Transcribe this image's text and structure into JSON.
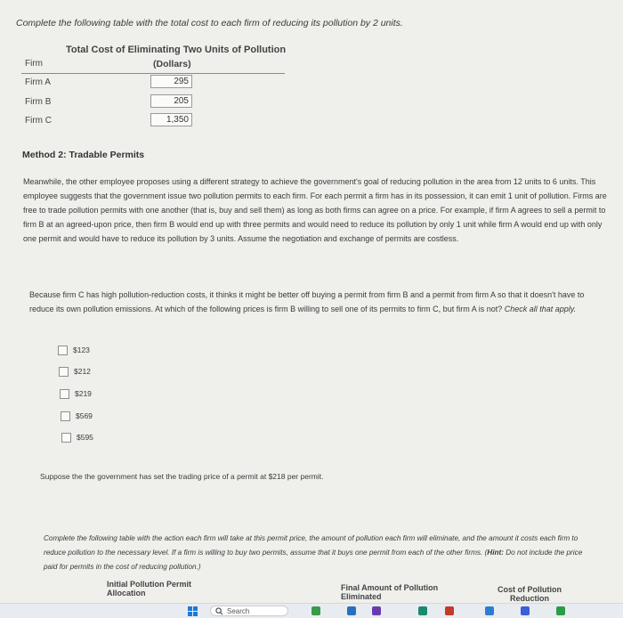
{
  "instructions_top": "Complete the following table with the total cost to each firm of reducing its pollution by 2 units.",
  "table1": {
    "title": "Total Cost of Eliminating Two Units of Pollution",
    "col_firm": "Firm",
    "col_cost": "(Dollars)",
    "rows": [
      {
        "firm": "Firm A",
        "value": "295"
      },
      {
        "firm": "Firm B",
        "value": "205"
      },
      {
        "firm": "Firm C",
        "value": "1,350"
      }
    ]
  },
  "method_heading": "Method 2: Tradable Permits",
  "paragraph1": "Meanwhile, the other employee proposes using a different strategy to achieve the government's goal of reducing pollution in the area from 12 units to 6 units. This employee suggests that the government issue two pollution permits to each firm. For each permit a firm has in its possession, it can emit 1 unit of pollution. Firms are free to trade pollution permits with one another (that is, buy and sell them) as long as both firms can agree on a price. For example, if firm A agrees to sell a permit to firm B at an agreed-upon price, then firm B would end up with three permits and would need to reduce its pollution by only 1 unit while firm A would end up with only one permit and would have to reduce its pollution by 3 units. Assume the negotiation and exchange of permits are costless.",
  "paragraph2": "Because firm C has high pollution-reduction costs, it thinks it might be better off buying a permit from firm B and a permit from firm A so that it doesn't have to reduce its own pollution emissions. At which of the following prices is firm B willing to sell one of its permits to firm C, but firm A is not?",
  "check_all": "Check all that apply.",
  "options": [
    "$123",
    "$212",
    "$219",
    "$569",
    "$595"
  ],
  "suppose_text": "Suppose the the government has set the trading price of a permit at $218 per permit.",
  "instructions2_a": "Complete the following table with the action each firm will take at this permit price, the amount of pollution each firm will eliminate, and the amount it costs each firm to reduce pollution to the necessary level. If a firm is willing to buy two permits, assume that it buys one permit from each of the other firms. (",
  "hint_label": "Hint:",
  "instructions2_b": " Do not include the price paid for permits in the cost of reducing pollution.)",
  "table2_headers": {
    "initial_allocation": "Initial Pollution Permit Allocation",
    "final_amount": "Final Amount of Pollution Eliminated",
    "cost": "Cost of Pollution Reduction"
  },
  "taskbar": {
    "search_placeholder": "Search"
  }
}
